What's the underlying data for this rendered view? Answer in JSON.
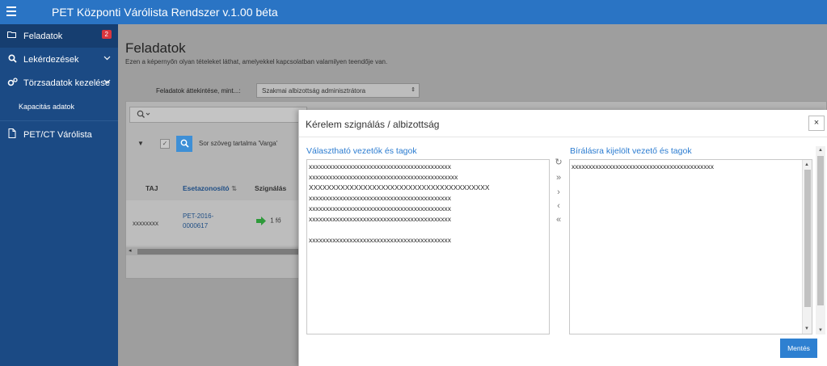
{
  "app": {
    "title": "PET Központi Várólista Rendszer v.1.00 béta"
  },
  "sidebar": {
    "items": [
      {
        "label": "Feladatok",
        "icon": "folder-open-icon",
        "badge": "2"
      },
      {
        "label": "Lekérdezések",
        "icon": "search-icon"
      },
      {
        "label": "Törzsadatok kezelése",
        "icon": "cogs-icon"
      },
      {
        "label": "Kapacitás adatok"
      },
      {
        "label": "PET/CT Várólista",
        "icon": "file-icon"
      }
    ]
  },
  "page": {
    "title": "Feladatok",
    "description": "Ezen a képernyőn olyan tételeket láthat, amelyekkel kapcsolatban valamilyen teendője van.",
    "overview_label": "Feladatok áttekintése, mint...:",
    "overview_value": "Szakmai albizottság adminisztrátora"
  },
  "grid": {
    "filter_text": "Sor szöveg tartalma 'Varga'",
    "headers": {
      "taj": "TAJ",
      "id": "Esetazonosító",
      "sign": "Szignálás"
    },
    "rows": [
      {
        "taj": "xxxxxxxx",
        "id": "PET-2016-0000617",
        "sign": "1 fő"
      }
    ]
  },
  "modal": {
    "title": "Kérelem szignálás / albizottság",
    "close": "×",
    "available_label": "Választható vezetők és tagok",
    "selected_label": "Bírálásra kijelölt vezető és tagok",
    "available_items": [
      "xxxxxxxxxxxxxxxxxxxxxxxxxxxxxxxxxxxxxxxxxx",
      "xxxxxxxxxxxxxxxxxxxxxxxxxxxxxxxxxxxxxxxxxxxx",
      "XXXXXXXXXXXXXXXXXXXXXXXXXXXXXXXXXXXXXXXX",
      "xxxxxxxxxxxxxxxxxxxxxxxxxxxxxxxxxxxxxxxxxx",
      "xxxxxxxxxxxxxxxxxxxxxxxxxxxxxxxxxxxxxxxxxx",
      "xxxxxxxxxxxxxxxxxxxxxxxxxxxxxxxxxxxxxxxxxx",
      "",
      "xxxxxxxxxxxxxxxxxxxxxxxxxxxxxxxxxxxxxxxxxx"
    ],
    "selected_items": [
      "xxxxxxxxxxxxxxxxxxxxxxxxxxxxxxxxxxxxxxxxxx"
    ],
    "buttons": {
      "refresh": "↻",
      "move_all_right": "»",
      "move_right": "›",
      "move_left": "‹",
      "move_all_left": "«"
    },
    "save_label": "Mentés"
  }
}
